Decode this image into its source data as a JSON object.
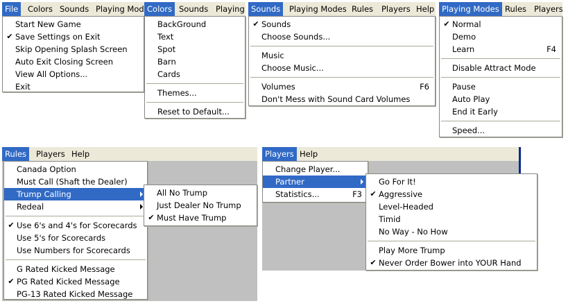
{
  "file_panel": {
    "menubar": [
      {
        "label": "File",
        "active": true
      },
      {
        "label": "Colors"
      },
      {
        "label": "Sounds"
      },
      {
        "label": "Playing Modes"
      }
    ],
    "items": [
      {
        "label": "Start New Game"
      },
      {
        "label": "Save Settings on Exit",
        "checked": true
      },
      {
        "label": "Skip Opening Splash Screen"
      },
      {
        "label": "Auto Exit Closing Screen"
      },
      {
        "label": "View All Options..."
      },
      {
        "label": "Exit"
      }
    ]
  },
  "colors_panel": {
    "menubar": [
      {
        "label": "Colors",
        "active": true
      },
      {
        "label": "Sounds"
      },
      {
        "label": "Playing"
      }
    ],
    "items": [
      {
        "label": "BackGround"
      },
      {
        "label": "Text"
      },
      {
        "label": "Spot"
      },
      {
        "label": "Barn"
      },
      {
        "label": "Cards"
      },
      {
        "separator": true
      },
      {
        "label": "Themes..."
      },
      {
        "separator": true
      },
      {
        "label": "Reset to Default..."
      }
    ]
  },
  "sounds_panel": {
    "menubar": [
      {
        "label": "Sounds",
        "active": true
      },
      {
        "label": "Playing Modes"
      },
      {
        "label": "Rules"
      },
      {
        "label": "Players"
      },
      {
        "label": "Help"
      }
    ],
    "items": [
      {
        "label": "Sounds",
        "checked": true
      },
      {
        "label": "Choose Sounds..."
      },
      {
        "separator": true
      },
      {
        "label": "Music"
      },
      {
        "label": "Choose Music..."
      },
      {
        "separator": true
      },
      {
        "label": "Volumes",
        "shortcut": "F6"
      },
      {
        "label": "Don't Mess with Sound Card Volumes"
      }
    ]
  },
  "modes_panel": {
    "menubar": [
      {
        "label": "Playing Modes",
        "active": true
      },
      {
        "label": "Rules"
      },
      {
        "label": "Players"
      }
    ],
    "items": [
      {
        "label": "Normal",
        "checked": true
      },
      {
        "label": "Demo"
      },
      {
        "label": "Learn",
        "shortcut": "F4"
      },
      {
        "separator": true
      },
      {
        "label": "Disable Attract Mode"
      },
      {
        "separator": true
      },
      {
        "label": "Pause"
      },
      {
        "label": "Auto Play"
      },
      {
        "label": "End it Early"
      },
      {
        "separator": true
      },
      {
        "label": "Speed..."
      }
    ]
  },
  "rules_panel": {
    "menubar": [
      {
        "label": "Rules",
        "active": true
      },
      {
        "label": "Players"
      },
      {
        "label": "Help"
      }
    ],
    "items": [
      {
        "label": "Canada Option"
      },
      {
        "label": "Must Call (Shaft the Dealer)"
      },
      {
        "label": "Trump Calling",
        "submenu": true,
        "highlighted": true
      },
      {
        "label": "Redeal",
        "submenu": true
      },
      {
        "separator": true
      },
      {
        "label": "Use 6's and 4's for Scorecards",
        "checked": true
      },
      {
        "label": "Use 5's for Scorecards"
      },
      {
        "label": "Use Numbers for Scorecards"
      },
      {
        "separator": true
      },
      {
        "label": "G Rated Kicked Message"
      },
      {
        "label": "PG Rated Kicked Message",
        "checked": true
      },
      {
        "label": "PG-13 Rated Kicked Message"
      }
    ],
    "submenu": [
      {
        "label": "All No Trump"
      },
      {
        "label": "Just Dealer No Trump"
      },
      {
        "label": "Must Have Trump",
        "checked": true
      }
    ]
  },
  "players_panel": {
    "menubar": [
      {
        "label": "Players",
        "active": true
      },
      {
        "label": "Help"
      }
    ],
    "items": [
      {
        "label": "Change Player..."
      },
      {
        "label": "Partner",
        "submenu": true,
        "highlighted": true
      },
      {
        "label": "Statistics...",
        "shortcut": "F3"
      }
    ],
    "submenu": [
      {
        "label": "Go For It!"
      },
      {
        "label": "Aggressive",
        "checked": true
      },
      {
        "label": "Level-Headed"
      },
      {
        "label": "Timid"
      },
      {
        "label": "No Way - No How"
      },
      {
        "separator": true
      },
      {
        "label": "Play More Trump"
      },
      {
        "label": "Never Order Bower into YOUR Hand",
        "checked": true
      }
    ]
  },
  "glyphs": {
    "check": "✔"
  },
  "colors": {
    "menubar": "#ece9d8",
    "highlight": "#316ac5",
    "client": "#c0c0c0"
  }
}
